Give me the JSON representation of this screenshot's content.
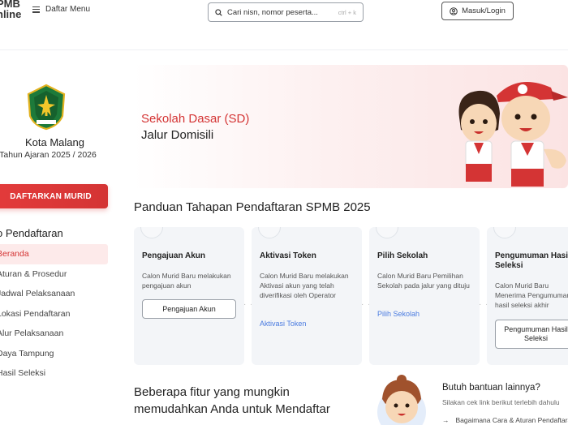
{
  "header": {
    "logo_line1": "PMB",
    "logo_line2": "nline",
    "menu_label": "Daftar Menu",
    "search_placeholder": "Cari nisn, nomor peserta...",
    "search_shortcut": "ctrl + k",
    "login_label": "Masuk/Login"
  },
  "sidebar": {
    "city": "Kota Malang",
    "year": "Tahun Ajaran 2025 / 2026",
    "register_button": "DAFTARKAN MURID",
    "nav_heading": "o Pendaftaran",
    "items": [
      {
        "label": "Beranda",
        "active": true
      },
      {
        "label": "Aturan & Prosedur",
        "active": false
      },
      {
        "label": "Jadwal Pelaksanaan",
        "active": false
      },
      {
        "label": "Lokasi Pendaftaran",
        "active": false
      },
      {
        "label": "Alur Pelaksanaan",
        "active": false
      },
      {
        "label": "Daya Tampung",
        "active": false
      },
      {
        "label": "Hasil Seleksi",
        "active": false
      }
    ]
  },
  "hero": {
    "level": "Sekolah Dasar (SD)",
    "track": "Jalur Domisili"
  },
  "guide": {
    "title": "Panduan Tahapan Pendaftaran SPMB 2025",
    "steps": [
      {
        "title": "Pengajuan Akun",
        "desc": "Calon Murid Baru melakukan pengajuan akun",
        "button": "Pengajuan Akun"
      },
      {
        "title": "Aktivasi Token",
        "desc": "Calon Murid Baru melakukan Aktivasi akun yang telah diverifikasi oleh Operator",
        "link": "Aktivasi Token"
      },
      {
        "title": "Pilih Sekolah",
        "desc": "Calon Murid Baru Pemilihan Sekolah pada jalur yang dituju",
        "link": "Pilih Sekolah"
      },
      {
        "title": "Pengumuman Hasil Seleksi",
        "desc": "Calon Murid Baru Menerima Pengumuman hasil seleksi akhir",
        "button": "Pengumuman Hasil Seleksi"
      }
    ]
  },
  "features": {
    "line1": "Beberapa fitur yang mungkin",
    "line2": "memudahkan Anda untuk Mendaftar"
  },
  "help": {
    "title": "Butuh bantuan lainnya?",
    "subtitle": "Silakan cek link berikut terlebih dahulu",
    "link_arrow": "→",
    "link1": "Bagaimana Cara & Aturan Pendaftaran"
  },
  "colors": {
    "accent": "#d43434",
    "link": "#4a7be0",
    "card_bg": "#f3f5f8"
  }
}
